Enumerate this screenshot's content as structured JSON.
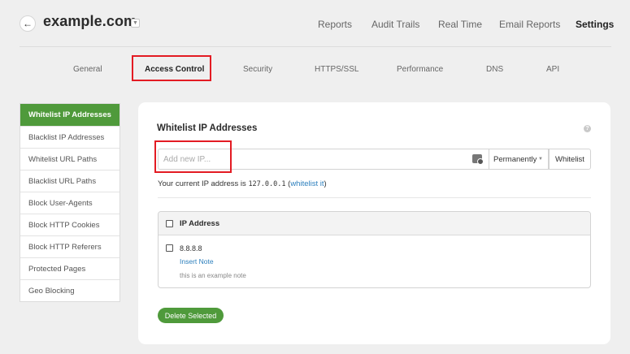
{
  "header": {
    "back_icon": "back-arrow-icon",
    "site_name": "example.com",
    "nav": [
      "Reports",
      "Audit Trails",
      "Real Time",
      "Email Reports",
      "Settings"
    ],
    "active_nav": "Settings"
  },
  "subtabs": {
    "items": [
      "General",
      "Access Control",
      "Security",
      "HTTPS/SSL",
      "Performance",
      "DNS",
      "API"
    ],
    "active": "Access Control"
  },
  "sidebar": {
    "items": [
      "Whitelist IP Addresses",
      "Blacklist IP Addresses",
      "Whitelist URL Paths",
      "Blacklist URL Paths",
      "Block User-Agents",
      "Block HTTP Cookies",
      "Block HTTP Referers",
      "Protected Pages",
      "Geo Blocking"
    ],
    "active": "Whitelist IP Addresses"
  },
  "panel": {
    "title": "Whitelist IP Addresses",
    "help_icon": "question-circle-icon",
    "input_placeholder": "Add new IP...",
    "duration_value": "Permanently",
    "action_label": "Whitelist",
    "ip_info_prefix": "Your current IP address is",
    "current_ip": "127.0.0.1",
    "whitelist_it_label": "whitelist it",
    "table": {
      "header": "IP Address",
      "rows": [
        {
          "ip": "8.8.8.8",
          "note_link": "Insert Note",
          "note": "this is an example note"
        }
      ]
    },
    "delete_label": "Delete Selected"
  },
  "colors": {
    "accent_green": "#4f9a3b",
    "link_blue": "#2c7fbd",
    "highlight_red": "#e31b23"
  }
}
